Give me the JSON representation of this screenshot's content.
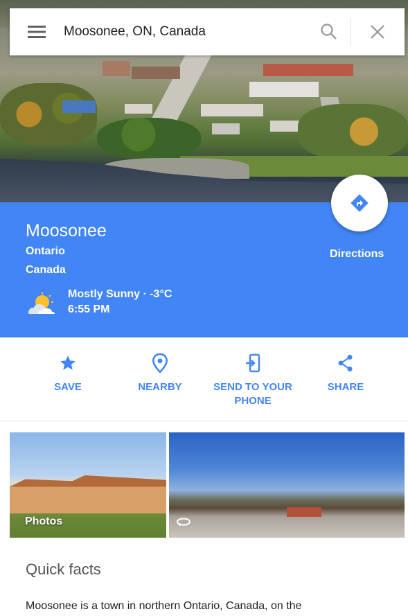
{
  "search": {
    "query": "Moosonee, ON, Canada"
  },
  "place": {
    "name": "Moosonee",
    "region": "Ontario",
    "country": "Canada",
    "weather": "Mostly Sunny · -3°C",
    "time": "6:55 PM"
  },
  "directions": {
    "label": "Directions"
  },
  "actions": {
    "save": "SAVE",
    "nearby": "NEARBY",
    "send_line1": "SEND TO YOUR",
    "send_line2": "PHONE",
    "share": "SHARE"
  },
  "photos": {
    "label": "Photos"
  },
  "quick_facts": {
    "title": "Quick facts",
    "description": "Moosonee is a town in northern Ontario, Canada, on the"
  },
  "colors": {
    "accent": "#4285f4",
    "panel_text": "#ffffff"
  },
  "icons": [
    "menu-icon",
    "search-icon",
    "close-icon",
    "directions-icon",
    "weather-partly-sunny-icon",
    "star-icon",
    "location-pin-icon",
    "send-to-phone-icon",
    "share-icon",
    "panorama-360-icon"
  ]
}
